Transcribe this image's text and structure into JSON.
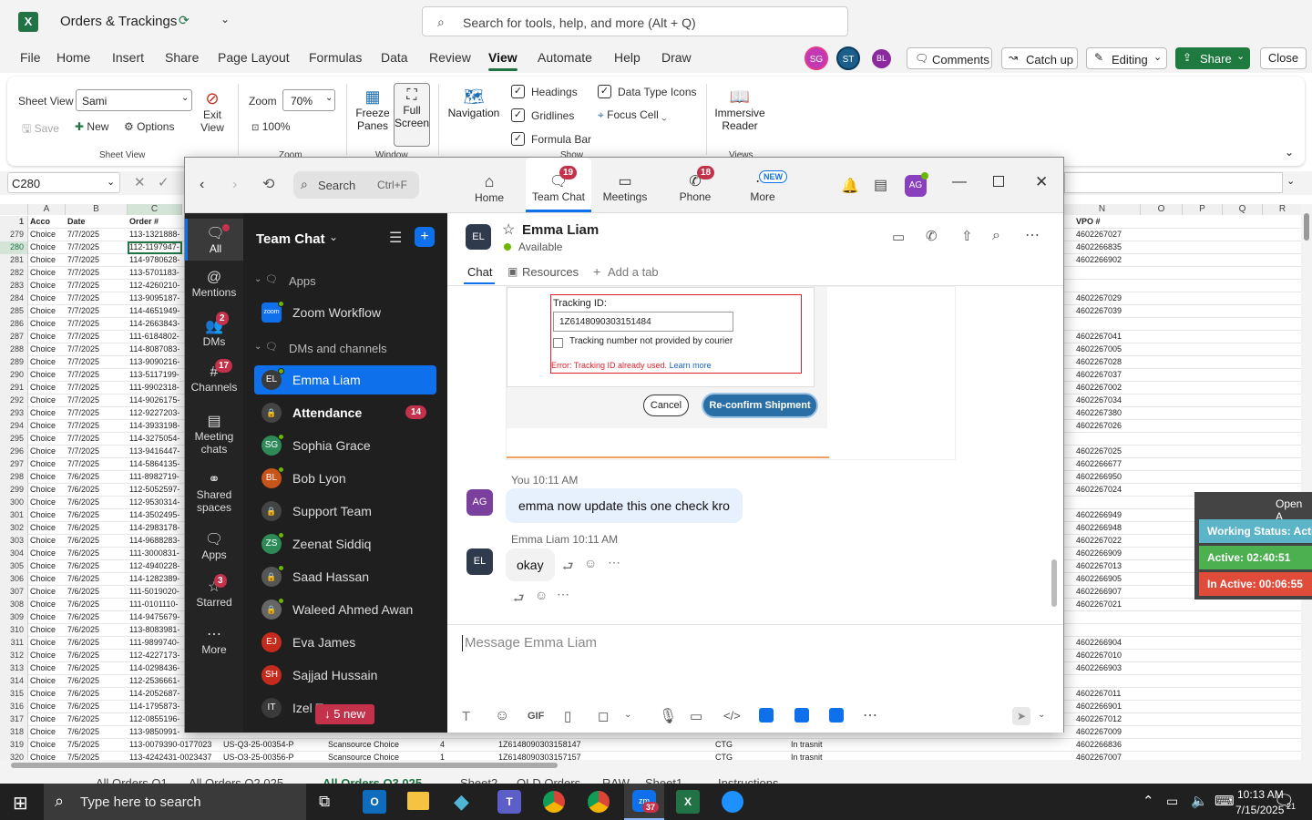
{
  "excel": {
    "doc_title": "Orders & Trackings",
    "search_placeholder": "Search for tools, help, and more (Alt + Q)",
    "avatars": [
      "SG",
      "ST",
      "BL"
    ],
    "buttons": {
      "comments": "Comments",
      "catch_up": "Catch up",
      "editing": "Editing",
      "share": "Share",
      "close": "Close"
    },
    "menu": [
      "File",
      "Home",
      "Insert",
      "Share",
      "Page Layout",
      "Formulas",
      "Data",
      "Review",
      "View",
      "Automate",
      "Help",
      "Draw"
    ],
    "active_menu": "View",
    "ribbon": {
      "sheet_view_label": "Sheet View",
      "sheet_view_value": "Sami",
      "save": "Save",
      "new": "New",
      "options": "Options",
      "exit_view": "Exit View",
      "group_sheet_view": "Sheet View",
      "zoom_label": "Zoom",
      "zoom_value": "70%",
      "zoom_100": "100%",
      "group_zoom": "Zoom",
      "freeze": "Freeze Panes",
      "full_screen": "Full Screen",
      "group_window": "Window",
      "navigation": "Navigation",
      "headings": "Headings",
      "gridlines": "Gridlines",
      "formula_bar": "Formula Bar",
      "data_type_icons": "Data Type Icons",
      "focus_cell": "Focus Cell",
      "group_show": "Show",
      "immersive": "Immersive Reader",
      "group_views": "Views"
    },
    "name_box": "C280",
    "columns": [
      "A",
      "B",
      "C",
      "N",
      "O",
      "P",
      "Q",
      "R"
    ],
    "header_row": {
      "num": "1",
      "a": "Acco",
      "b": "Date",
      "c": "Order #",
      "n": "VPO #"
    },
    "rows": [
      {
        "n": "279",
        "a": "Choice",
        "b": "7/7/2025",
        "c": "113-1321888-",
        "v": "4602267027"
      },
      {
        "n": "280",
        "a": "Choice",
        "b": "7/7/2025",
        "c": "112-1197947-",
        "v": "4602266835"
      },
      {
        "n": "281",
        "a": "Choice",
        "b": "7/7/2025",
        "c": "114-9780628-",
        "v": "4602266902"
      },
      {
        "n": "282",
        "a": "Choice",
        "b": "7/7/2025",
        "c": "113-5701183-",
        "v": ""
      },
      {
        "n": "283",
        "a": "Choice",
        "b": "7/7/2025",
        "c": "112-4260210-",
        "v": ""
      },
      {
        "n": "284",
        "a": "Choice",
        "b": "7/7/2025",
        "c": "113-9095187-",
        "v": "4602267029"
      },
      {
        "n": "285",
        "a": "Choice",
        "b": "7/7/2025",
        "c": "114-4651949-",
        "v": "4602267039"
      },
      {
        "n": "286",
        "a": "Choice",
        "b": "7/7/2025",
        "c": "114-2663843-",
        "v": ""
      },
      {
        "n": "287",
        "a": "Choice",
        "b": "7/7/2025",
        "c": "111-6184802-",
        "v": "4602267041"
      },
      {
        "n": "288",
        "a": "Choice",
        "b": "7/7/2025",
        "c": "114-8087083-",
        "v": "4602267005"
      },
      {
        "n": "289",
        "a": "Choice",
        "b": "7/7/2025",
        "c": "113-9090216-",
        "v": "4602267028"
      },
      {
        "n": "290",
        "a": "Choice",
        "b": "7/7/2025",
        "c": "113-5117199-",
        "v": "4602267037"
      },
      {
        "n": "291",
        "a": "Choice",
        "b": "7/7/2025",
        "c": "111-9902318-",
        "v": "4602267002"
      },
      {
        "n": "292",
        "a": "Choice",
        "b": "7/7/2025",
        "c": "114-9026175-",
        "v": "4602267034"
      },
      {
        "n": "293",
        "a": "Choice",
        "b": "7/7/2025",
        "c": "112-9227203-",
        "v": "4602267380"
      },
      {
        "n": "294",
        "a": "Choice",
        "b": "7/7/2025",
        "c": "114-3933198-",
        "v": "4602267026"
      },
      {
        "n": "295",
        "a": "Choice",
        "b": "7/7/2025",
        "c": "114-3275054-",
        "v": ""
      },
      {
        "n": "296",
        "a": "Choice",
        "b": "7/7/2025",
        "c": "113-9416447-",
        "v": "4602267025"
      },
      {
        "n": "297",
        "a": "Choice",
        "b": "7/7/2025",
        "c": "114-5864135-",
        "v": "4602266677"
      },
      {
        "n": "298",
        "a": "Choice",
        "b": "7/6/2025",
        "c": "111-8982719-",
        "v": "4602266950"
      },
      {
        "n": "299",
        "a": "Choice",
        "b": "7/6/2025",
        "c": "112-5052597-",
        "v": "4602267024"
      },
      {
        "n": "300",
        "a": "Choice",
        "b": "7/6/2025",
        "c": "112-9530314-",
        "v": ""
      },
      {
        "n": "301",
        "a": "Choice",
        "b": "7/6/2025",
        "c": "114-3502495-",
        "v": "4602266949"
      },
      {
        "n": "302",
        "a": "Choice",
        "b": "7/6/2025",
        "c": "114-2983178-",
        "v": "4602266948"
      },
      {
        "n": "303",
        "a": "Choice",
        "b": "7/6/2025",
        "c": "114-9688283-",
        "v": "4602267022"
      },
      {
        "n": "304",
        "a": "Choice",
        "b": "7/6/2025",
        "c": "111-3000831-",
        "v": "4602266909"
      },
      {
        "n": "305",
        "a": "Choice",
        "b": "7/6/2025",
        "c": "112-4940228-",
        "v": "4602267013"
      },
      {
        "n": "306",
        "a": "Choice",
        "b": "7/6/2025",
        "c": "114-1282389-",
        "v": "4602266905"
      },
      {
        "n": "307",
        "a": "Choice",
        "b": "7/6/2025",
        "c": "111-5019020-",
        "v": "4602266907"
      },
      {
        "n": "308",
        "a": "Choice",
        "b": "7/6/2025",
        "c": "111-0101110-",
        "v": "4602267021"
      },
      {
        "n": "309",
        "a": "Choice",
        "b": "7/6/2025",
        "c": "114-9475679-",
        "v": ""
      },
      {
        "n": "310",
        "a": "Choice",
        "b": "7/6/2025",
        "c": "113-8083981-",
        "v": ""
      },
      {
        "n": "311",
        "a": "Choice",
        "b": "7/6/2025",
        "c": "111-9899740-",
        "v": "4602266904"
      },
      {
        "n": "312",
        "a": "Choice",
        "b": "7/6/2025",
        "c": "112-4227173-",
        "v": "4602267010"
      },
      {
        "n": "313",
        "a": "Choice",
        "b": "7/6/2025",
        "c": "114-0298436-",
        "v": "4602266903"
      },
      {
        "n": "314",
        "a": "Choice",
        "b": "7/6/2025",
        "c": "112-2536661-",
        "v": ""
      },
      {
        "n": "315",
        "a": "Choice",
        "b": "7/6/2025",
        "c": "114-2052687-",
        "v": "4602267011"
      },
      {
        "n": "316",
        "a": "Choice",
        "b": "7/6/2025",
        "c": "114-1795873-",
        "v": "4602266901"
      },
      {
        "n": "317",
        "a": "Choice",
        "b": "7/6/2025",
        "c": "112-0855196-",
        "v": "4602267012"
      },
      {
        "n": "318",
        "a": "Choice",
        "b": "7/6/2025",
        "c": "113-9850991-",
        "v": "4602267009"
      },
      {
        "n": "319",
        "a": "Choice",
        "b": "7/5/2025",
        "c": "113-0079390-0177023",
        "d": "US-Q3-25-00354-P",
        "e": "Scansource Choice",
        "f": "4",
        "g": "1Z6148090303158147",
        "h": "CTG",
        "i": "In trasnit",
        "v": "4602266836"
      },
      {
        "n": "320",
        "a": "Choice",
        "b": "7/5/2025",
        "c": "113-4242431-0023437",
        "d": "US-Q3-25-00356-P",
        "e": "Scansource Choice",
        "f": "1",
        "g": "1Z6148090303157157",
        "h": "CTG",
        "i": "In trasnit",
        "v": "4602267007"
      }
    ],
    "sheet_tabs": [
      "All Orders Q1",
      "All Orders Q2 025",
      "All Orders Q3 025",
      "Sheet2",
      "OLD Orders",
      "RAW",
      "Sheet1",
      "Instructions"
    ],
    "status_widget": {
      "open": "Open A",
      "working": "Working Status: Acti",
      "active": "Active: 02:40:51",
      "inactive": "In Active: 00:06:55"
    }
  },
  "teams": {
    "search": "Search",
    "search_shortcut": "Ctrl+F",
    "tabs": [
      {
        "label": "Home",
        "badge": ""
      },
      {
        "label": "Team Chat",
        "badge": "19"
      },
      {
        "label": "Meetings",
        "badge": ""
      },
      {
        "label": "Phone",
        "badge": "18"
      },
      {
        "label": "More",
        "badge": "NEW"
      }
    ],
    "user_avatar": "AG",
    "rail": [
      {
        "label": "All",
        "badge": ""
      },
      {
        "label": "Mentions",
        "badge": ""
      },
      {
        "label": "DMs",
        "badge": "2"
      },
      {
        "label": "Channels",
        "badge": "17"
      },
      {
        "label": "Meeting chats",
        "badge": ""
      },
      {
        "label": "Shared spaces",
        "badge": ""
      },
      {
        "label": "Apps",
        "badge": ""
      },
      {
        "label": "Starred",
        "badge": "3"
      },
      {
        "label": "More",
        "badge": ""
      }
    ],
    "panel_title": "Team Chat",
    "section_apps": "Apps",
    "app_item": "Zoom Workflow",
    "app_icon": "zoom",
    "section_dms": "DMs and channels",
    "contacts": [
      {
        "initials": "EL",
        "name": "Emma Liam",
        "color": "#3a3a3a",
        "badge": ""
      },
      {
        "initials": "",
        "name": "Attendance",
        "color": "#444",
        "badge": "14"
      },
      {
        "initials": "SG",
        "name": "Sophia Grace",
        "color": "#2e8b57",
        "badge": ""
      },
      {
        "initials": "BL",
        "name": "Bob Lyon",
        "color": "#c9541a",
        "badge": ""
      },
      {
        "initials": "",
        "name": "Support Team",
        "color": "#444",
        "badge": ""
      },
      {
        "initials": "ZS",
        "name": "Zeenat Siddiq",
        "color": "#2e8b57",
        "badge": ""
      },
      {
        "initials": "",
        "name": "Saad Hassan",
        "color": "#555",
        "badge": ""
      },
      {
        "initials": "",
        "name": "Waleed Ahmed Awan",
        "color": "#666",
        "badge": ""
      },
      {
        "initials": "EJ",
        "name": "Eva James",
        "color": "#c42b1c",
        "badge": ""
      },
      {
        "initials": "SH",
        "name": "Sajjad Hussain",
        "color": "#c42b1c",
        "badge": ""
      },
      {
        "initials": "IT",
        "name": "Izel T",
        "color": "#3a3a3a",
        "badge": ""
      }
    ],
    "new_messages": "5 new",
    "chat": {
      "peer_initials": "EL",
      "peer_name": "Emma Liam",
      "status": "Available",
      "tabs": [
        "Chat",
        "Resources",
        "Add a tab"
      ],
      "shot": {
        "tracking_label": "Tracking ID:",
        "tracking_value": "1Z6148090303151484",
        "not_provided": "Tracking number not provided by courier",
        "error": "Error: Tracking ID already used.",
        "learn_more": "Learn more",
        "cancel": "Cancel",
        "reconfirm": "Re-confirm Shipment"
      },
      "messages": [
        {
          "author": "You",
          "time": "10:11 AM",
          "initials": "AG",
          "text": "emma now update this one check kro"
        },
        {
          "author": "Emma Liam",
          "time": "10:11 AM",
          "initials": "EL",
          "text": "okay"
        }
      ],
      "composer_placeholder": "Message Emma Liam"
    }
  },
  "taskbar": {
    "search": "Type here to search",
    "time": "10:13 AM",
    "date": "7/15/2025",
    "notif": "21",
    "zoom_badge": "37"
  },
  "colors": {
    "excel_green": "#217346",
    "teams_blue": "#0e71eb",
    "rail_bg": "#242424",
    "panel_bg": "#1f1f1f"
  }
}
